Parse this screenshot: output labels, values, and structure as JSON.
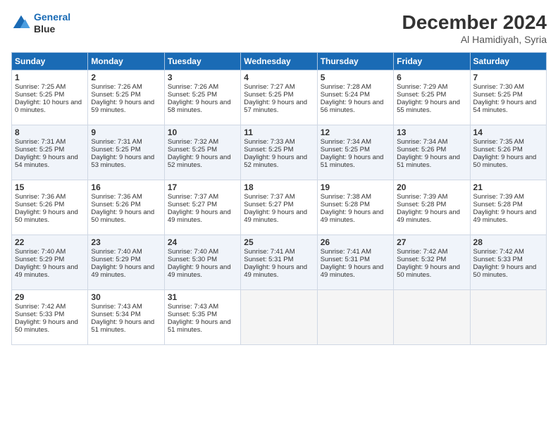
{
  "header": {
    "logo_line1": "General",
    "logo_line2": "Blue",
    "month": "December 2024",
    "location": "Al Hamidiyah, Syria"
  },
  "days_of_week": [
    "Sunday",
    "Monday",
    "Tuesday",
    "Wednesday",
    "Thursday",
    "Friday",
    "Saturday"
  ],
  "weeks": [
    [
      {
        "day": "1",
        "sunrise": "Sunrise: 7:25 AM",
        "sunset": "Sunset: 5:25 PM",
        "daylight": "Daylight: 10 hours and 0 minutes."
      },
      {
        "day": "2",
        "sunrise": "Sunrise: 7:26 AM",
        "sunset": "Sunset: 5:25 PM",
        "daylight": "Daylight: 9 hours and 59 minutes."
      },
      {
        "day": "3",
        "sunrise": "Sunrise: 7:26 AM",
        "sunset": "Sunset: 5:25 PM",
        "daylight": "Daylight: 9 hours and 58 minutes."
      },
      {
        "day": "4",
        "sunrise": "Sunrise: 7:27 AM",
        "sunset": "Sunset: 5:25 PM",
        "daylight": "Daylight: 9 hours and 57 minutes."
      },
      {
        "day": "5",
        "sunrise": "Sunrise: 7:28 AM",
        "sunset": "Sunset: 5:24 PM",
        "daylight": "Daylight: 9 hours and 56 minutes."
      },
      {
        "day": "6",
        "sunrise": "Sunrise: 7:29 AM",
        "sunset": "Sunset: 5:25 PM",
        "daylight": "Daylight: 9 hours and 55 minutes."
      },
      {
        "day": "7",
        "sunrise": "Sunrise: 7:30 AM",
        "sunset": "Sunset: 5:25 PM",
        "daylight": "Daylight: 9 hours and 54 minutes."
      }
    ],
    [
      {
        "day": "8",
        "sunrise": "Sunrise: 7:31 AM",
        "sunset": "Sunset: 5:25 PM",
        "daylight": "Daylight: 9 hours and 54 minutes."
      },
      {
        "day": "9",
        "sunrise": "Sunrise: 7:31 AM",
        "sunset": "Sunset: 5:25 PM",
        "daylight": "Daylight: 9 hours and 53 minutes."
      },
      {
        "day": "10",
        "sunrise": "Sunrise: 7:32 AM",
        "sunset": "Sunset: 5:25 PM",
        "daylight": "Daylight: 9 hours and 52 minutes."
      },
      {
        "day": "11",
        "sunrise": "Sunrise: 7:33 AM",
        "sunset": "Sunset: 5:25 PM",
        "daylight": "Daylight: 9 hours and 52 minutes."
      },
      {
        "day": "12",
        "sunrise": "Sunrise: 7:34 AM",
        "sunset": "Sunset: 5:25 PM",
        "daylight": "Daylight: 9 hours and 51 minutes."
      },
      {
        "day": "13",
        "sunrise": "Sunrise: 7:34 AM",
        "sunset": "Sunset: 5:26 PM",
        "daylight": "Daylight: 9 hours and 51 minutes."
      },
      {
        "day": "14",
        "sunrise": "Sunrise: 7:35 AM",
        "sunset": "Sunset: 5:26 PM",
        "daylight": "Daylight: 9 hours and 50 minutes."
      }
    ],
    [
      {
        "day": "15",
        "sunrise": "Sunrise: 7:36 AM",
        "sunset": "Sunset: 5:26 PM",
        "daylight": "Daylight: 9 hours and 50 minutes."
      },
      {
        "day": "16",
        "sunrise": "Sunrise: 7:36 AM",
        "sunset": "Sunset: 5:26 PM",
        "daylight": "Daylight: 9 hours and 50 minutes."
      },
      {
        "day": "17",
        "sunrise": "Sunrise: 7:37 AM",
        "sunset": "Sunset: 5:27 PM",
        "daylight": "Daylight: 9 hours and 49 minutes."
      },
      {
        "day": "18",
        "sunrise": "Sunrise: 7:37 AM",
        "sunset": "Sunset: 5:27 PM",
        "daylight": "Daylight: 9 hours and 49 minutes."
      },
      {
        "day": "19",
        "sunrise": "Sunrise: 7:38 AM",
        "sunset": "Sunset: 5:28 PM",
        "daylight": "Daylight: 9 hours and 49 minutes."
      },
      {
        "day": "20",
        "sunrise": "Sunrise: 7:39 AM",
        "sunset": "Sunset: 5:28 PM",
        "daylight": "Daylight: 9 hours and 49 minutes."
      },
      {
        "day": "21",
        "sunrise": "Sunrise: 7:39 AM",
        "sunset": "Sunset: 5:28 PM",
        "daylight": "Daylight: 9 hours and 49 minutes."
      }
    ],
    [
      {
        "day": "22",
        "sunrise": "Sunrise: 7:40 AM",
        "sunset": "Sunset: 5:29 PM",
        "daylight": "Daylight: 9 hours and 49 minutes."
      },
      {
        "day": "23",
        "sunrise": "Sunrise: 7:40 AM",
        "sunset": "Sunset: 5:29 PM",
        "daylight": "Daylight: 9 hours and 49 minutes."
      },
      {
        "day": "24",
        "sunrise": "Sunrise: 7:40 AM",
        "sunset": "Sunset: 5:30 PM",
        "daylight": "Daylight: 9 hours and 49 minutes."
      },
      {
        "day": "25",
        "sunrise": "Sunrise: 7:41 AM",
        "sunset": "Sunset: 5:31 PM",
        "daylight": "Daylight: 9 hours and 49 minutes."
      },
      {
        "day": "26",
        "sunrise": "Sunrise: 7:41 AM",
        "sunset": "Sunset: 5:31 PM",
        "daylight": "Daylight: 9 hours and 49 minutes."
      },
      {
        "day": "27",
        "sunrise": "Sunrise: 7:42 AM",
        "sunset": "Sunset: 5:32 PM",
        "daylight": "Daylight: 9 hours and 50 minutes."
      },
      {
        "day": "28",
        "sunrise": "Sunrise: 7:42 AM",
        "sunset": "Sunset: 5:33 PM",
        "daylight": "Daylight: 9 hours and 50 minutes."
      }
    ],
    [
      {
        "day": "29",
        "sunrise": "Sunrise: 7:42 AM",
        "sunset": "Sunset: 5:33 PM",
        "daylight": "Daylight: 9 hours and 50 minutes."
      },
      {
        "day": "30",
        "sunrise": "Sunrise: 7:43 AM",
        "sunset": "Sunset: 5:34 PM",
        "daylight": "Daylight: 9 hours and 51 minutes."
      },
      {
        "day": "31",
        "sunrise": "Sunrise: 7:43 AM",
        "sunset": "Sunset: 5:35 PM",
        "daylight": "Daylight: 9 hours and 51 minutes."
      },
      null,
      null,
      null,
      null
    ]
  ]
}
